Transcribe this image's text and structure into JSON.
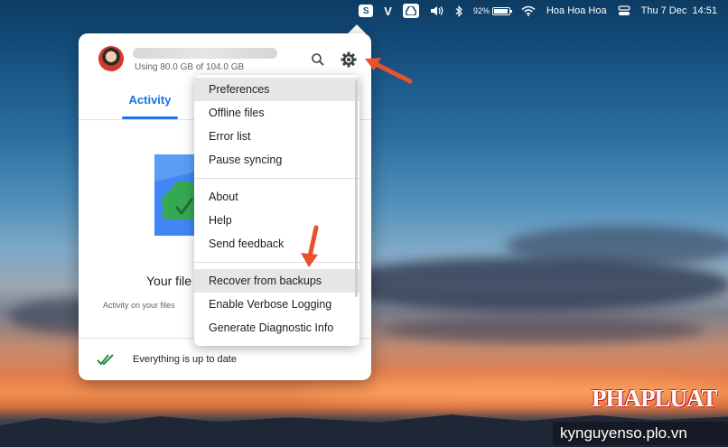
{
  "menubar": {
    "s_label": "S",
    "v_label": "V",
    "battery_text": "92%",
    "battery_level": 0.92,
    "user_name": "Hoa Hoa Hoa",
    "datetime": "Thu 7 Dec  14:51"
  },
  "panel": {
    "usage": "Using 80.0 GB of 104.0 GB",
    "tab_activity": "Activity",
    "empty_title": "Your file",
    "empty_subtitle": "Activity on your files",
    "status": "Everything is up to date"
  },
  "menu": {
    "group1": [
      "Preferences",
      "Offline files",
      "Error list",
      "Pause syncing"
    ],
    "group2": [
      "About",
      "Help",
      "Send feedback"
    ],
    "group3": [
      "Recover from backups",
      "Enable Verbose Logging",
      "Generate Diagnostic Info"
    ]
  },
  "watermark": {
    "logo": "PHAPLUAT",
    "url": "kynguyenso.plo.vn"
  },
  "colors": {
    "accent": "#1a73e8",
    "arrow": "#e8522a",
    "check": "#1e8e3e"
  }
}
